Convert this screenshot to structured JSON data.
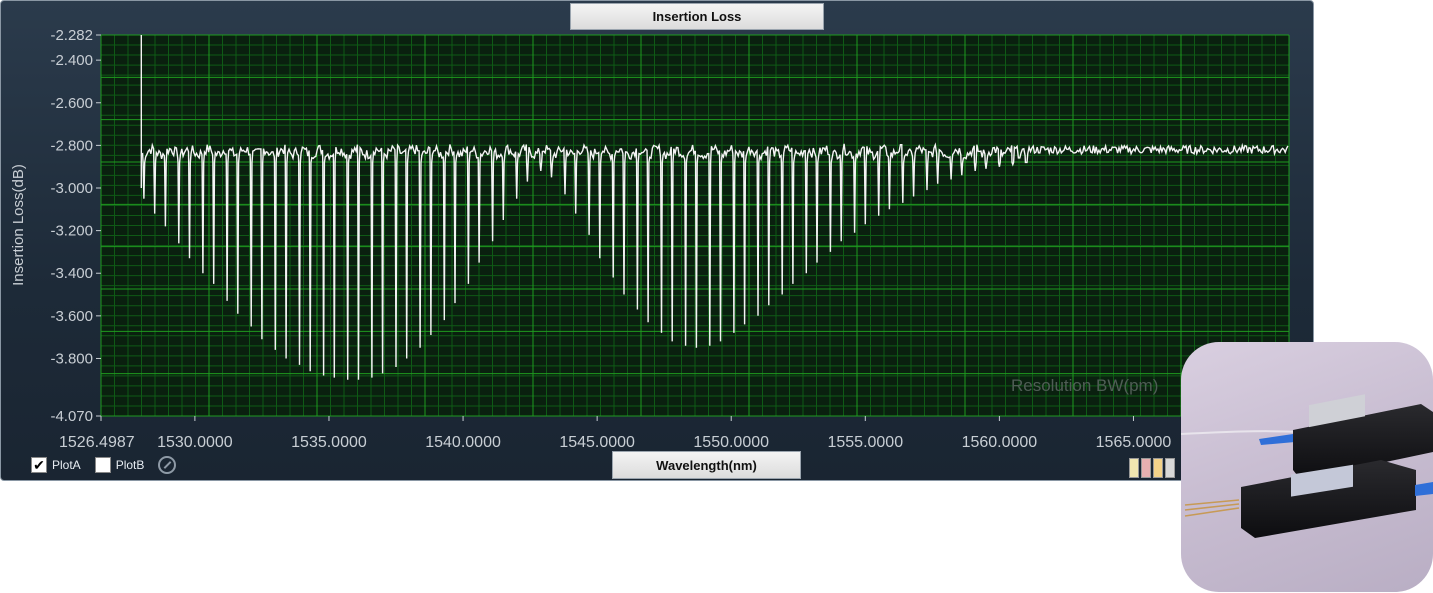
{
  "window": {
    "title": "Insertion Loss",
    "xaxis_tab": "Wavelength(nm)",
    "watermark": "Resolution BW(pm)"
  },
  "legend": {
    "items": [
      {
        "label": "PlotA",
        "checked": true
      },
      {
        "label": "PlotB",
        "checked": false
      }
    ],
    "icons": [
      "clear-icon",
      "color-palette-icon"
    ]
  },
  "colors": {
    "plot_bg": "#0a200f",
    "grid_major": "#1f9a1f",
    "grid_minor": "#0f5a16",
    "trace": "#f4f4f4",
    "axis_text": "#c8ced4"
  },
  "chart_data": {
    "type": "line",
    "title": "Insertion Loss",
    "xlabel": "Wavelength(nm)",
    "ylabel": "Insertion Loss(dB)",
    "xlim": [
      1526.4987,
      1570.8
    ],
    "ylim": [
      -4.07,
      -2.282
    ],
    "x_ticks": [
      "1526.4987",
      "1530.0000",
      "1535.0000",
      "1540.0000",
      "1545.0000",
      "1550.0000",
      "1555.0000",
      "1560.0000",
      "1565.0000"
    ],
    "x_tick_values": [
      1526.4987,
      1530,
      1535,
      1540,
      1545,
      1550,
      1555,
      1560,
      1565
    ],
    "y_ticks": [
      "-2.282",
      "-2.400",
      "-2.600",
      "-2.800",
      "-3.000",
      "-3.200",
      "-3.400",
      "-3.600",
      "-3.800",
      "-4.070"
    ],
    "y_tick_values": [
      -2.282,
      -2.4,
      -2.6,
      -2.8,
      -3.0,
      -3.2,
      -3.4,
      -3.6,
      -3.8,
      -4.07
    ],
    "grid": true,
    "series": [
      {
        "name": "PlotA",
        "baseline": -2.83,
        "start_x": 1528.0,
        "start_spike_y": -2.282,
        "dips": [
          {
            "x": 1528.1,
            "y": -3.05
          },
          {
            "x": 1528.5,
            "y": -3.12
          },
          {
            "x": 1528.9,
            "y": -3.18
          },
          {
            "x": 1529.4,
            "y": -3.26
          },
          {
            "x": 1529.8,
            "y": -3.33
          },
          {
            "x": 1530.3,
            "y": -3.4
          },
          {
            "x": 1530.7,
            "y": -3.45
          },
          {
            "x": 1531.2,
            "y": -3.53
          },
          {
            "x": 1531.6,
            "y": -3.59
          },
          {
            "x": 1532.1,
            "y": -3.65
          },
          {
            "x": 1532.5,
            "y": -3.71
          },
          {
            "x": 1533.0,
            "y": -3.76
          },
          {
            "x": 1533.4,
            "y": -3.8
          },
          {
            "x": 1533.9,
            "y": -3.83
          },
          {
            "x": 1534.3,
            "y": -3.86
          },
          {
            "x": 1534.8,
            "y": -3.88
          },
          {
            "x": 1535.2,
            "y": -3.89
          },
          {
            "x": 1535.7,
            "y": -3.9
          },
          {
            "x": 1536.1,
            "y": -3.9
          },
          {
            "x": 1536.6,
            "y": -3.89
          },
          {
            "x": 1537.0,
            "y": -3.87
          },
          {
            "x": 1537.5,
            "y": -3.84
          },
          {
            "x": 1537.9,
            "y": -3.8
          },
          {
            "x": 1538.4,
            "y": -3.75
          },
          {
            "x": 1538.8,
            "y": -3.69
          },
          {
            "x": 1539.3,
            "y": -3.62
          },
          {
            "x": 1539.7,
            "y": -3.54
          },
          {
            "x": 1540.2,
            "y": -3.45
          },
          {
            "x": 1540.6,
            "y": -3.35
          },
          {
            "x": 1541.1,
            "y": -3.25
          },
          {
            "x": 1541.5,
            "y": -3.15
          },
          {
            "x": 1542.0,
            "y": -3.05
          },
          {
            "x": 1542.4,
            "y": -2.97
          },
          {
            "x": 1542.9,
            "y": -2.92
          },
          {
            "x": 1543.3,
            "y": -2.95
          },
          {
            "x": 1543.8,
            "y": -3.03
          },
          {
            "x": 1544.2,
            "y": -3.12
          },
          {
            "x": 1544.7,
            "y": -3.22
          },
          {
            "x": 1545.1,
            "y": -3.33
          },
          {
            "x": 1545.6,
            "y": -3.42
          },
          {
            "x": 1546.0,
            "y": -3.5
          },
          {
            "x": 1546.5,
            "y": -3.57
          },
          {
            "x": 1546.9,
            "y": -3.63
          },
          {
            "x": 1547.4,
            "y": -3.68
          },
          {
            "x": 1547.8,
            "y": -3.72
          },
          {
            "x": 1548.3,
            "y": -3.74
          },
          {
            "x": 1548.7,
            "y": -3.75
          },
          {
            "x": 1549.2,
            "y": -3.74
          },
          {
            "x": 1549.6,
            "y": -3.72
          },
          {
            "x": 1550.1,
            "y": -3.68
          },
          {
            "x": 1550.5,
            "y": -3.64
          },
          {
            "x": 1551.0,
            "y": -3.6
          },
          {
            "x": 1551.4,
            "y": -3.55
          },
          {
            "x": 1551.9,
            "y": -3.5
          },
          {
            "x": 1552.3,
            "y": -3.45
          },
          {
            "x": 1552.8,
            "y": -3.4
          },
          {
            "x": 1553.2,
            "y": -3.35
          },
          {
            "x": 1553.7,
            "y": -3.3
          },
          {
            "x": 1554.1,
            "y": -3.25
          },
          {
            "x": 1554.6,
            "y": -3.21
          },
          {
            "x": 1555.0,
            "y": -3.17
          },
          {
            "x": 1555.5,
            "y": -3.13
          },
          {
            "x": 1555.9,
            "y": -3.1
          },
          {
            "x": 1556.4,
            "y": -3.07
          },
          {
            "x": 1556.8,
            "y": -3.04
          },
          {
            "x": 1557.3,
            "y": -3.01
          },
          {
            "x": 1557.7,
            "y": -2.98
          },
          {
            "x": 1558.2,
            "y": -2.96
          },
          {
            "x": 1558.6,
            "y": -2.94
          },
          {
            "x": 1559.1,
            "y": -2.92
          },
          {
            "x": 1559.5,
            "y": -2.91
          },
          {
            "x": 1560.0,
            "y": -2.9
          },
          {
            "x": 1560.5,
            "y": -2.89
          },
          {
            "x": 1561.0,
            "y": -2.88
          }
        ],
        "end_x": 1570.8
      }
    ]
  }
}
